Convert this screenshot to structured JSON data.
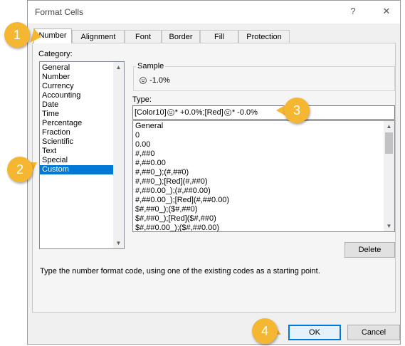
{
  "window": {
    "title": "Format Cells",
    "help_label": "?",
    "close_label": "✕"
  },
  "tabs": [
    {
      "label": "Number"
    },
    {
      "label": "Alignment"
    },
    {
      "label": "Font"
    },
    {
      "label": "Border"
    },
    {
      "label": "Fill"
    },
    {
      "label": "Protection"
    }
  ],
  "category": {
    "label": "Category:",
    "items": [
      "General",
      "Number",
      "Currency",
      "Accounting",
      "Date",
      "Time",
      "Percentage",
      "Fraction",
      "Scientific",
      "Text",
      "Special",
      "Custom"
    ],
    "selected": "Custom"
  },
  "sample": {
    "label": "Sample",
    "value": "-1.0%",
    "icon": "sad-face-icon"
  },
  "type": {
    "label": "Type:",
    "value_prefix": "[Color10]",
    "value_mid": "* +0.0%;[Red]",
    "value_suffix": "* -0.0%",
    "formats": [
      "General",
      "0",
      "0.00",
      "#,##0",
      "#,##0.00",
      "#,##0_);(#,##0)",
      "#,##0_);[Red](#,##0)",
      "#,##0.00_);(#,##0.00)",
      "#,##0.00_);[Red](#,##0.00)",
      "$#,##0_);($#,##0)",
      "$#,##0_);[Red]($#,##0)",
      "$#,##0.00_);($#,##0.00)"
    ]
  },
  "buttons": {
    "delete": "Delete",
    "ok": "OK",
    "cancel": "Cancel"
  },
  "hint": "Type the number format code, using one of the existing codes as a starting point.",
  "callouts": [
    "1",
    "2",
    "3",
    "4"
  ],
  "colors": {
    "selection": "#0078d7",
    "callout": "#f5b731"
  }
}
